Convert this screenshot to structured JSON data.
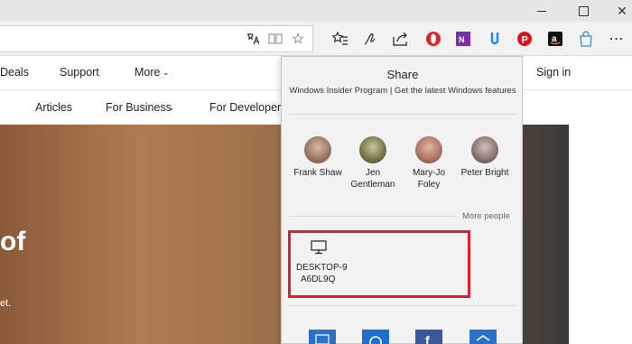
{
  "toolbar": {
    "icons": [
      "translate-icon",
      "reading-view-icon",
      "favorite-star-icon",
      "favorites-hub-icon",
      "pen-icon",
      "share-icon",
      "opera-icon",
      "onenote-icon",
      "kiwi-icon",
      "pinterest-icon",
      "amazon-icon",
      "bag-icon",
      "more-icon"
    ]
  },
  "nav": {
    "top": [
      "Deals",
      "Support",
      "More"
    ],
    "signin": "Sign in",
    "sub": [
      "Articles",
      "For Business",
      "For Developers"
    ]
  },
  "hero": {
    "headline": "of",
    "subtext": "et."
  },
  "share": {
    "title": "Share",
    "subtitle": "Windows Insider Program | Get the latest Windows features",
    "people": [
      {
        "name_line1": "Frank Shaw",
        "name_line2": ""
      },
      {
        "name_line1": "Jen",
        "name_line2": "Gentleman"
      },
      {
        "name_line1": "Mary-Jo",
        "name_line2": "Foley"
      },
      {
        "name_line1": "Peter Bright",
        "name_line2": ""
      }
    ],
    "more_people": "More people",
    "device": {
      "line1": "DESKTOP-9",
      "line2": "A6DL9Q"
    },
    "highlight_color": "#e0202a"
  }
}
